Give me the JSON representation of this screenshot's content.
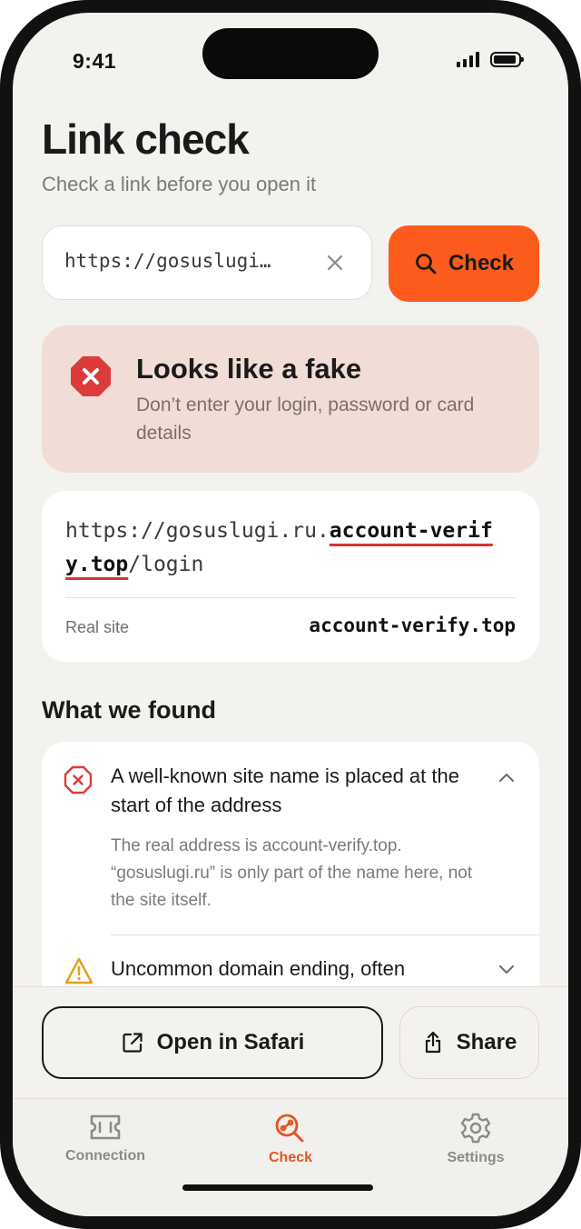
{
  "status_bar": {
    "time": "9:41"
  },
  "header": {
    "title": "Link check",
    "subtitle": "Check a link before you open it"
  },
  "search": {
    "value": "https://gosuslugi.ru.account-verify.top/login",
    "display_value": "https://gosuslugi…",
    "check_label": "Check"
  },
  "verdict": {
    "title": "Looks like a fake",
    "description": "Don’t enter your login, password or card details",
    "color": "#e03a3a"
  },
  "url_analysis": {
    "url_prefix": "https://gosuslugi.ru.",
    "url_highlight": "account-verify.top",
    "url_suffix": "/login",
    "real_site_label": "Real site",
    "real_site_value": "account-verify.top"
  },
  "findings": {
    "section_title": "What we found",
    "items": [
      {
        "icon": "x-octagon-icon",
        "title": "A well-known site name is placed at the start of the address",
        "description": "The real address is account-verify.top. “gosuslugi.ru” is only part of the name here, not the site itself.",
        "expanded": true
      },
      {
        "icon": "warning-triangle-icon",
        "title": "Uncommon domain ending, often",
        "expanded": false
      }
    ]
  },
  "actions": {
    "open_label": "Open in Safari",
    "share_label": "Share"
  },
  "tabbar": {
    "tabs": [
      {
        "label": "Connection",
        "icon": "ticket-icon",
        "active": false
      },
      {
        "label": "Check",
        "icon": "link-search-icon",
        "active": true
      },
      {
        "label": "Settings",
        "icon": "gear-icon",
        "active": false
      }
    ]
  },
  "colors": {
    "accent": "#fd5a1e",
    "danger": "#e03a3a",
    "warning": "#e0a21a",
    "background": "#f4f2ee"
  }
}
